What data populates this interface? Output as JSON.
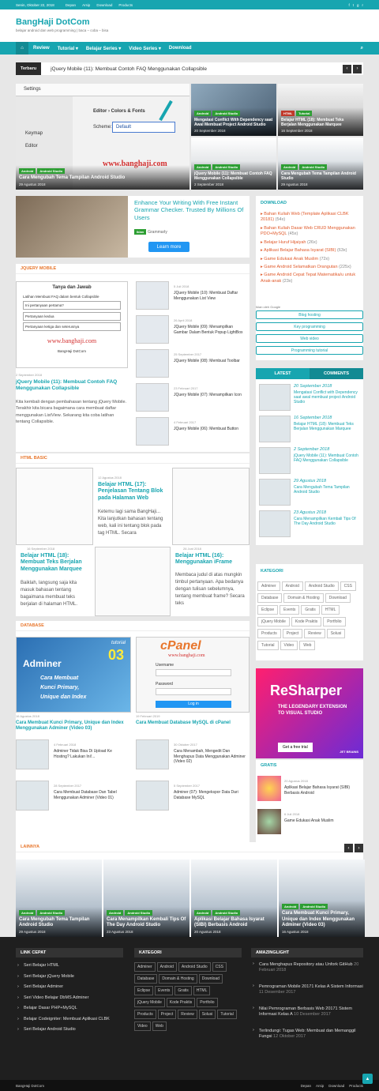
{
  "topbar": {
    "date": "Senin, Oktober 22, 2018",
    "links": [
      "Depan",
      "Arsip",
      "Download",
      "Products"
    ]
  },
  "header": {
    "title": "BangHaji DotCom",
    "subtitle": "belajar android dan web programming | baca – coba – bisa"
  },
  "nav": {
    "items": [
      "Review",
      "Tutorial ▾",
      "Belajar Series ▾",
      "Video Series ▾",
      "Download"
    ]
  },
  "ticker": {
    "label": "Terbaru",
    "text": "jQuery Mobile (11): Membuat Contoh FAQ Menggunakan Collapsible"
  },
  "featured": {
    "main": {
      "tags": [
        "Android",
        "Android Studio"
      ],
      "title": "Cara Mengubah Tema Tampilan Android Studio",
      "date": "29 Agustus 2018",
      "img_text": "www.banghaji.com",
      "settings": "Settings",
      "editor": "Editor › Colors & Fonts",
      "scheme": "Scheme:",
      "default": "Default",
      "keymap": "Keymap",
      "editor2": "Editor"
    },
    "tr": {
      "tags": [
        "Android",
        "Android Studio"
      ],
      "title": "Mengatasi Conflict With Dependency saat Awal Membuat Project Android Studio",
      "date": "20 September 2018"
    },
    "tr2": {
      "tags": [
        "HTML",
        "Tutorial"
      ],
      "title": "Belajar HTML (18): Membuat Teks Berjalan Menggunakan Marquee",
      "date": "16 September 2018"
    },
    "br1": {
      "tags": [
        "Android",
        "Android Studio"
      ],
      "title": "jQuery Mobile (11): Membuat Contoh FAQ Menggunakan Collapsible",
      "date": "2 September 2018"
    },
    "br2": {
      "tags": [
        "Android",
        "Android Studio"
      ],
      "title": "Cara Mengubah Tema Tampilan Android Studio",
      "date": "29 Agustus 2018"
    }
  },
  "ad": {
    "headline": "Enhance Your Writing With Free Instant Grammar Checker. Trusted By Millions Of Users",
    "iklan": "Iklan",
    "brand": "Grammarly",
    "cta": "Learn more"
  },
  "jquery": {
    "header": "JQUERY MOBILE",
    "main": {
      "date": "2 September 2018",
      "title": "jQuery Mobile (11): Membuat Contoh FAQ Menggunakan Collapsible",
      "excerpt": "Kita kembali dengan pembahasan tentang jQuery Mobile. Terakhir kita bicara bagaimana cara membuat daftar menggunakan ListView. Sekarang kita coba latihan tentang Collapsible.",
      "img_title": "Tanya dan Jawab",
      "img_lines": [
        "Latihan Membuat FAQ dalam bentuk Collapsible",
        "Ini pertanyaan pertama?",
        "Pertanyaan kedua",
        "Pertanyaan ketiga dan seterusnya"
      ],
      "img_site": "www.banghaji.com",
      "img_foot": "BangHaji DotCom"
    },
    "list": [
      {
        "date": "5 Juli 2018",
        "title": "JQuery Mobile (10): Membuat Daftar Menggunakan List View"
      },
      {
        "date": "26 April 2018",
        "title": "JQuery Mobile (09): Menampilkan Gambar Dalam Bentuk Popup LightBox"
      },
      {
        "date": "25 September 2017",
        "title": "JQuery Mobile (08): Membuat Toolbar"
      },
      {
        "date": "23 Februari 2017",
        "title": "JQuery Mobile (07): Menampilkan Icon"
      },
      {
        "date": "4 Februari 2017",
        "title": "JQuery Mobile (06): Membuat Button"
      }
    ]
  },
  "download": {
    "header": "DOWNLOAD",
    "items": [
      {
        "t": "Bahan Kuliah Web (Template Aplikasi CLBK 20181)",
        "c": "(54x)"
      },
      {
        "t": "Bahan Kuliah Dasar Web CRUD Menggunakan PDO+MySQL",
        "c": "(45x)"
      },
      {
        "t": "Belajar Huruf Hijaiyah",
        "c": "(26x)"
      },
      {
        "t": "Aplikasi Belajar Bahasa Isyarat (SIBI)",
        "c": "(63x)"
      },
      {
        "t": "Game Edukasi Anak Muslim",
        "c": "(72x)"
      },
      {
        "t": "Game Android Selamatkan Orangutan",
        "c": "(225x)"
      },
      {
        "t": "Game Android Cepat Tepat Matematika/u untuk Anak-anak",
        "c": "(23x)"
      }
    ],
    "google": "Iklan oleh Google",
    "buttons": [
      "Blog hosting",
      "Key programming",
      "Web video",
      "Programming tutorial"
    ]
  },
  "tabs": {
    "latest": "LATEST",
    "comments": "COMMENTS",
    "items": [
      {
        "date": "20 September 2018",
        "title": "Mengatasi Conflict with Dependency saat awal membuat project Android Studio"
      },
      {
        "date": "16 September 2018",
        "title": "Belajar HTML (18): Membuat Teks Berjalan Menggunakan Marquee"
      },
      {
        "date": "2 September 2018",
        "title": "jQuery Mobile (11): Membuat Contoh FAQ Menggunakan Collapsible"
      },
      {
        "date": "29 Agustus 2018",
        "title": "Cara Mengubah Tema Tampilan Android Studio"
      },
      {
        "date": "23 Agustus 2018",
        "title": "Cara Menampilkan Kembali Tips Of The Day Android Studio"
      }
    ]
  },
  "html_basic": {
    "header": "HTML BASIC",
    "posts": [
      {
        "date": "12 Agustus 2018",
        "title": "Belajar HTML (17): Penjelasan Tentang Blok pada Halaman Web",
        "excerpt": "Ketemu lagi sama BangHaji... Kita lanjutkan bahasan tentang web, kali ini tentang blok pada tag HTML. Secara"
      },
      {
        "date": "16 September 2018",
        "title": "Belajar HTML (18): Membuat Teks Berjalan Menggunakan Marquee",
        "excerpt": "Baiklah, langsung saja kita masuk bahasan tentang bagaimana membuat teks berjalan di halaman HTML."
      },
      {
        "date": "26 Juni 2018",
        "title": "Belajar HTML (16): Menggunakan iFrame",
        "excerpt": "Membaca judul di atas mungkin timbul pertanyaan. Apa bedanya dengan tulisan sebelumnya, tentang membuat frame? Secara teks"
      }
    ]
  },
  "kategori": {
    "header": "KATEGORI",
    "items": [
      "Adminer",
      "Android",
      "Android Studio",
      "CSS",
      "Database",
      "Domain & Hosting",
      "Download",
      "Eclipse",
      "Events",
      "Gratis",
      "HTML",
      "jQuery Mobile",
      "Kode Praktis",
      "Portfolio",
      "Products",
      "Project",
      "Review",
      "Solusi",
      "Tutorial",
      "Video",
      "Web"
    ]
  },
  "database": {
    "header": "DATABASE",
    "main1": {
      "date": "16 Agustus 2018",
      "title": "Cara Membuat Kunci Primary, Unique dan Index Menggunakan Adminer (Video 03)",
      "img_tut": "tutorial",
      "img_num": "03",
      "img_brand": "Adminer",
      "img_lines": [
        "Cara Membuat",
        "Kunci Primary,",
        "Unique dan Index"
      ]
    },
    "main2": {
      "date": "19 Februari 2019",
      "title": "Cara Membuat Database MySQL di cPanel",
      "logo": "cPanel",
      "site": "www.banghaji.com",
      "username": "Username",
      "password": "Password",
      "login": "Log in"
    },
    "list": [
      {
        "date": "4 Februari 2018",
        "title": "Adminer Tidak Bisa Di Upload Ke Hosting? Lakukan Ini!..."
      },
      {
        "date": "30 Oktober 2017",
        "title": "Cara Menambah, Mengedit Dan Menghapus Data Menggunakan Adminer (Video 02)"
      },
      {
        "date": "28 September 2017",
        "title": "Cara Membuat Database Dan Tabel Menggunakan Adminer (Video 01)"
      },
      {
        "date": "5 September 2017",
        "title": "Adminer (07): Mengekspor Data Dari Database MySQL"
      }
    ]
  },
  "ad2": {
    "brand": "ReSharper",
    "tagline": "THE LEGENDARY EXTENSION TO VISUAL STUDIO",
    "cta": "Get a free trial",
    "mini": "JET BRAINS"
  },
  "gratis": {
    "header": "GRATIS",
    "items": [
      {
        "date": "20 Agustus 2018",
        "title": "Aplikasi Belajar Bahasa Isyarat (SIBI) Berbasis Android"
      },
      {
        "date": "6 Juli 2018",
        "title": "Game Edukasi Anak Muslim"
      }
    ]
  },
  "lainnya": {
    "header": "LAINNYA",
    "items": [
      {
        "title": "Cara Mengubah Tema Tampilan Android Studio",
        "date": "29 Agustus 2018"
      },
      {
        "title": "Cara Menampilkan Kembali Tips Of The Day Android Studio",
        "date": "23 Agustus 2018"
      },
      {
        "title": "Aplikasi Belajar Bahasa Isyarat (SIBI) Berbasis Android",
        "date": "20 Agustus 2018"
      },
      {
        "title": "Cara Membuat Kunci Primary, Unique dan Index Menggunakan Adminer (Video 03)",
        "date": "16 Agustus 2018"
      }
    ],
    "tags": [
      "Android",
      "Android Studio"
    ]
  },
  "footer": {
    "link_header": "LINK CEPAT",
    "links": [
      "Seri Belajar HTML",
      "Seri Belajar jQuery Mobile",
      "Seri Belajar Adminer",
      "Seri Video Belajar DbMS Adminer",
      "Belajar Dasar PHP+MySQL",
      "Belajar Codeigniter: Membuat Aplikasi CLBK",
      "Seri Belajar Android Studio"
    ],
    "kat_header": "KATEGORI",
    "amaz_header": "AMAZINGLIGHT",
    "amaz": [
      {
        "t": "Cara Menghapus Repository atau Unfork GitHub",
        "d": "20 Februari 2018"
      },
      {
        "t": "Pemrograman Mobile 20171 Kelas A Sistem Informasi",
        "d": "11 Desember 2017"
      },
      {
        "t": "Nilai Pemrograman Berbasis Web 20171 Sistem Informasi Kelas A",
        "d": "10 Desember 2017"
      },
      {
        "t": "Terlindungi: Tugas Web: Membuat dan Memanggil Fungsi",
        "d": "12 Oktober 2017"
      }
    ]
  },
  "bottom": {
    "copy": "BangHaji DotCom",
    "links": [
      "Depan",
      "Arsip",
      "Download",
      "Products"
    ]
  },
  "colors": {
    "accent": "#17a5b0",
    "tag": "#2d9e33",
    "orange": "#e8762c"
  }
}
